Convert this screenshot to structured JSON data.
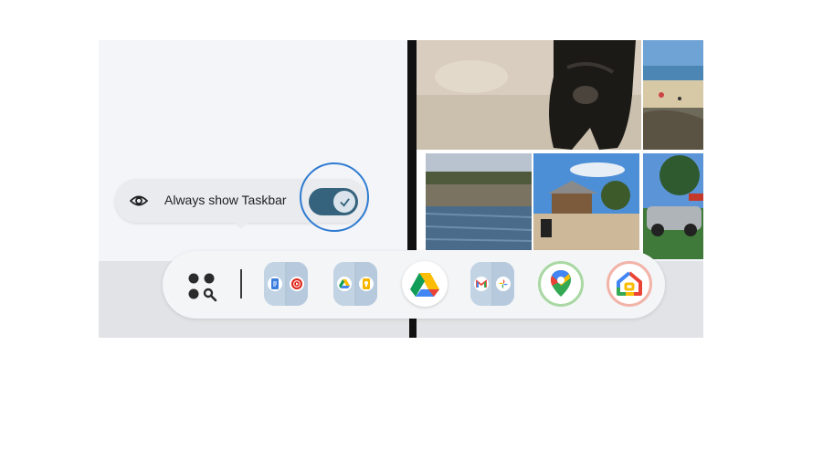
{
  "tooltip": {
    "label": "Always show Taskbar",
    "toggle_on": true
  },
  "icons": {
    "tooltip_icon": "eye-icon",
    "toggle_knob": "check-icon",
    "launcher": "app-launcher-search-icon"
  },
  "taskbar": {
    "apps": [
      {
        "name": "docs-youtube-music-pair",
        "icon_left": "docs-icon",
        "icon_right": "youtube-music-icon"
      },
      {
        "name": "drive-keep-pair",
        "icon_left": "drive-icon",
        "icon_right": "keep-icon"
      },
      {
        "name": "drive",
        "icon": "drive-icon"
      },
      {
        "name": "gmail-photos-pair",
        "icon_left": "gmail-icon",
        "icon_right": "photos-icon"
      },
      {
        "name": "maps",
        "icon": "maps-icon"
      },
      {
        "name": "home",
        "icon": "google-home-icon"
      }
    ]
  },
  "colors": {
    "toggle_track": "#35627d",
    "highlight_ring": "#2f7bd0",
    "tooltip_bg": "#e9ebef",
    "taskbar_bg": "#f4f5f7"
  }
}
